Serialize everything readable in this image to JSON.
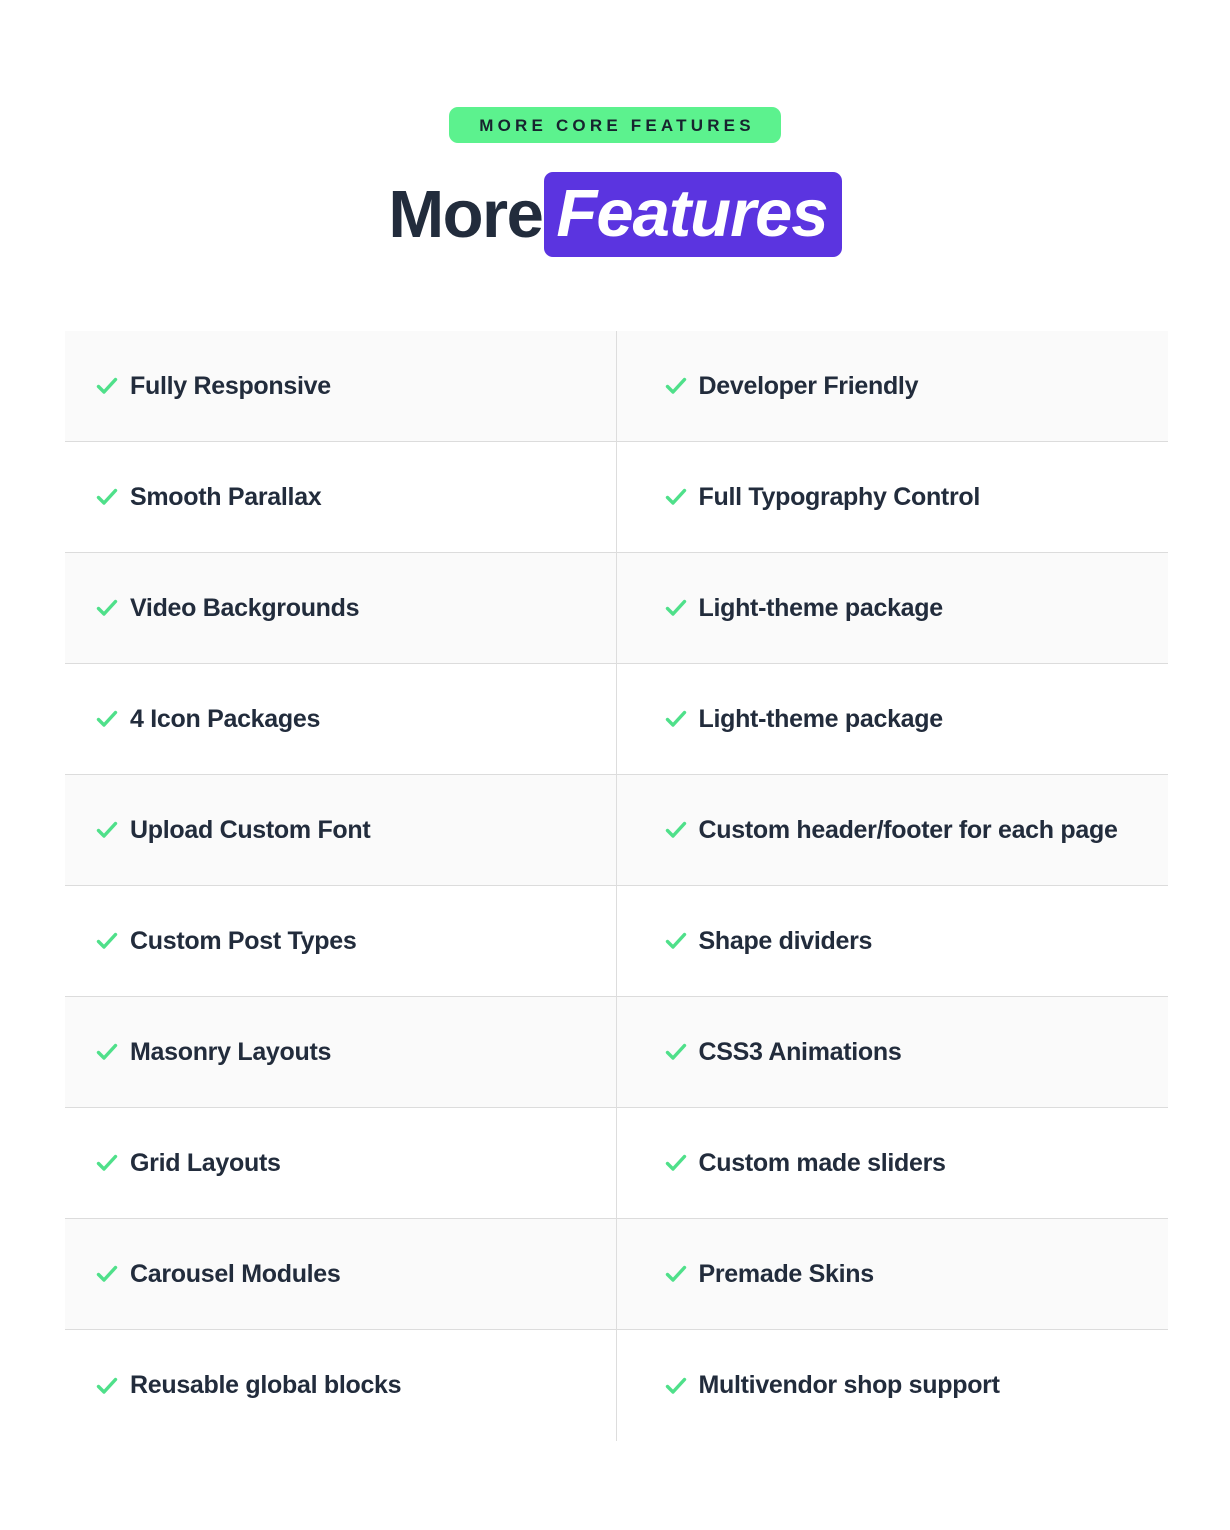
{
  "header": {
    "eyebrow": "MORE CORE FEATURES",
    "title_plain": "More",
    "title_highlight": "Features"
  },
  "colors": {
    "accent_green": "#5CF28E",
    "accent_purple": "#5B34E0",
    "text_dark": "#222c3c",
    "row_shaded": "#fafafa",
    "row_border": "#dcdcdc",
    "column_divider": "#dddddd"
  },
  "icons": {
    "check": "check-icon"
  },
  "features": {
    "left_column": [
      {
        "label": "Fully Responsive"
      },
      {
        "label": "Smooth Parallax"
      },
      {
        "label": "Video Backgrounds"
      },
      {
        "label": "4 Icon Packages"
      },
      {
        "label": "Upload Custom Font"
      },
      {
        "label": "Custom Post Types"
      },
      {
        "label": "Masonry Layouts"
      },
      {
        "label": "Grid Layouts"
      },
      {
        "label": "Carousel Modules"
      },
      {
        "label": "Reusable global blocks"
      }
    ],
    "right_column": [
      {
        "label": "Developer Friendly"
      },
      {
        "label": "Full Typography Control"
      },
      {
        "label": "Light-theme package"
      },
      {
        "label": "Light-theme package"
      },
      {
        "label": "Custom header/footer for each page"
      },
      {
        "label": "Shape dividers"
      },
      {
        "label": "CSS3 Animations"
      },
      {
        "label": "Custom made sliders"
      },
      {
        "label": "Premade Skins"
      },
      {
        "label": "Multivendor shop support"
      }
    ]
  }
}
